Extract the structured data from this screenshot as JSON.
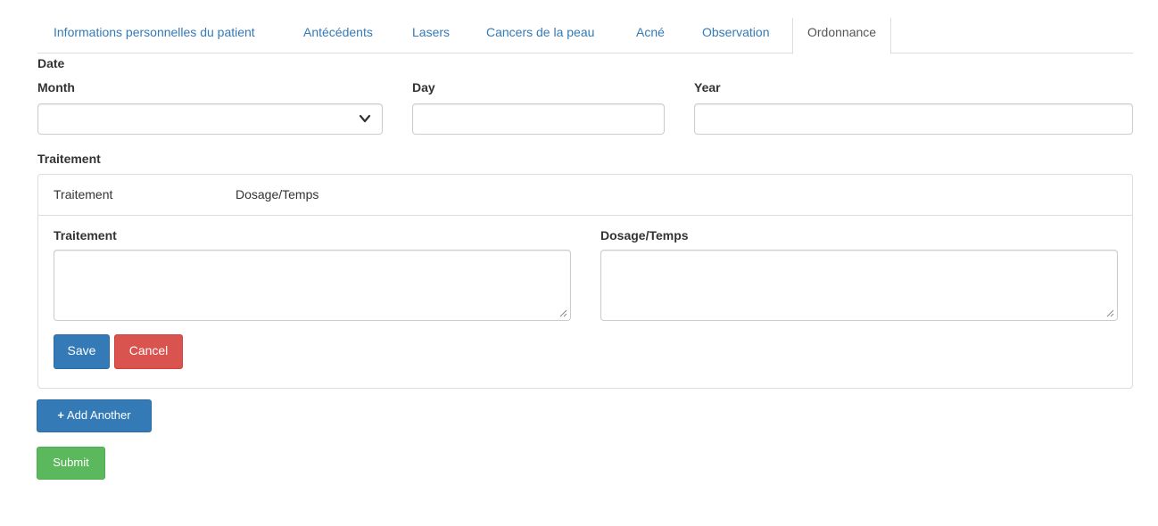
{
  "tabs": [
    {
      "label": "Informations personnelles du patient",
      "active": false
    },
    {
      "label": "Antécédents",
      "active": false
    },
    {
      "label": "Lasers",
      "active": false
    },
    {
      "label": "Cancers de la peau",
      "active": false
    },
    {
      "label": "Acné",
      "active": false
    },
    {
      "label": "Observation",
      "active": false
    },
    {
      "label": "Ordonnance",
      "active": true
    }
  ],
  "date": {
    "label": "Date",
    "month_label": "Month",
    "month_value": "",
    "day_label": "Day",
    "day_value": "",
    "year_label": "Year",
    "year_value": ""
  },
  "traitement": {
    "section_label": "Traitement",
    "table_headers": [
      "Traitement",
      "Dosage/Temps"
    ],
    "traitement_label": "Traitement",
    "traitement_value": "",
    "dosage_label": "Dosage/Temps",
    "dosage_value": "",
    "save_label": "Save",
    "cancel_label": "Cancel"
  },
  "add_another_label": "Add Another",
  "submit_label": "Submit",
  "colors": {
    "link": "#337ab7",
    "primary": "#337ab7",
    "danger": "#d9534f",
    "success": "#5cb85c"
  }
}
